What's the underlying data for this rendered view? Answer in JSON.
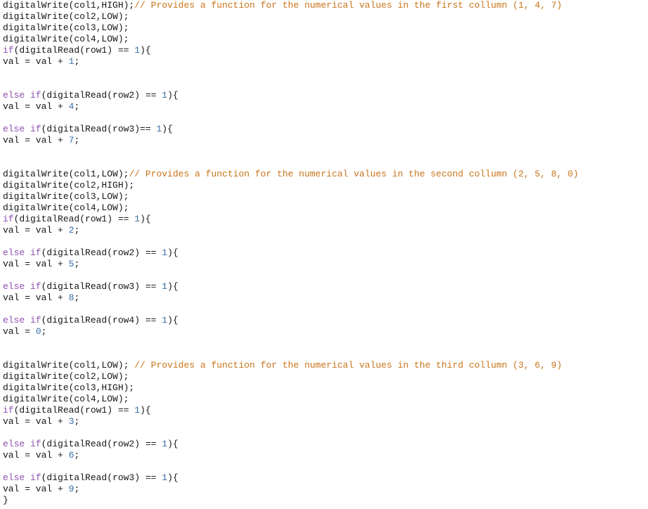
{
  "editor": {
    "language": "arduino-c",
    "background_color": "#ffffff",
    "colors": {
      "keyword": "#8f4faf",
      "number": "#3a6ea5",
      "comment": "#c8741b",
      "plain": "#161616"
    }
  },
  "code": {
    "lines": [
      {
        "segments": [
          {
            "t": "digitalWrite(col1,HIGH);",
            "c": "plain"
          },
          {
            "t": "// Provides a function for the numerical values in the first collumn (1, 4, 7)",
            "c": "comment"
          }
        ]
      },
      {
        "segments": [
          {
            "t": "digitalWrite(col2,LOW);",
            "c": "plain"
          }
        ]
      },
      {
        "segments": [
          {
            "t": "digitalWrite(col3,LOW);",
            "c": "plain"
          }
        ]
      },
      {
        "segments": [
          {
            "t": "digitalWrite(col4,LOW);",
            "c": "plain"
          }
        ]
      },
      {
        "segments": [
          {
            "t": "if",
            "c": "keyword"
          },
          {
            "t": "(digitalRead(row1) == ",
            "c": "plain"
          },
          {
            "t": "1",
            "c": "number"
          },
          {
            "t": "){",
            "c": "plain"
          }
        ]
      },
      {
        "segments": [
          {
            "t": "val = val + ",
            "c": "plain"
          },
          {
            "t": "1",
            "c": "number"
          },
          {
            "t": ";",
            "c": "plain"
          }
        ]
      },
      {
        "segments": []
      },
      {
        "segments": []
      },
      {
        "segments": [
          {
            "t": "else if",
            "c": "keyword"
          },
          {
            "t": "(digitalRead(row2) == ",
            "c": "plain"
          },
          {
            "t": "1",
            "c": "number"
          },
          {
            "t": "){",
            "c": "plain"
          }
        ]
      },
      {
        "segments": [
          {
            "t": "val = val + ",
            "c": "plain"
          },
          {
            "t": "4",
            "c": "number"
          },
          {
            "t": ";",
            "c": "plain"
          }
        ]
      },
      {
        "segments": []
      },
      {
        "segments": [
          {
            "t": "else if",
            "c": "keyword"
          },
          {
            "t": "(digitalRead(row3)== ",
            "c": "plain"
          },
          {
            "t": "1",
            "c": "number"
          },
          {
            "t": "){",
            "c": "plain"
          }
        ]
      },
      {
        "segments": [
          {
            "t": "val = val + ",
            "c": "plain"
          },
          {
            "t": "7",
            "c": "number"
          },
          {
            "t": ";",
            "c": "plain"
          }
        ]
      },
      {
        "segments": []
      },
      {
        "segments": []
      },
      {
        "segments": [
          {
            "t": "digitalWrite(col1,LOW);",
            "c": "plain"
          },
          {
            "t": "// Provides a function for the numerical values in the second collumn (2, 5, 8, 0)",
            "c": "comment"
          }
        ]
      },
      {
        "segments": [
          {
            "t": "digitalWrite(col2,HIGH);",
            "c": "plain"
          }
        ]
      },
      {
        "segments": [
          {
            "t": "digitalWrite(col3,LOW);",
            "c": "plain"
          }
        ]
      },
      {
        "segments": [
          {
            "t": "digitalWrite(col4,LOW);",
            "c": "plain"
          }
        ]
      },
      {
        "segments": [
          {
            "t": "if",
            "c": "keyword"
          },
          {
            "t": "(digitalRead(row1) == ",
            "c": "plain"
          },
          {
            "t": "1",
            "c": "number"
          },
          {
            "t": "){",
            "c": "plain"
          }
        ]
      },
      {
        "segments": [
          {
            "t": "val = val + ",
            "c": "plain"
          },
          {
            "t": "2",
            "c": "number"
          },
          {
            "t": ";",
            "c": "plain"
          }
        ]
      },
      {
        "segments": []
      },
      {
        "segments": [
          {
            "t": "else if",
            "c": "keyword"
          },
          {
            "t": "(digitalRead(row2) == ",
            "c": "plain"
          },
          {
            "t": "1",
            "c": "number"
          },
          {
            "t": "){",
            "c": "plain"
          }
        ]
      },
      {
        "segments": [
          {
            "t": "val = val + ",
            "c": "plain"
          },
          {
            "t": "5",
            "c": "number"
          },
          {
            "t": ";",
            "c": "plain"
          }
        ]
      },
      {
        "segments": []
      },
      {
        "segments": [
          {
            "t": "else if",
            "c": "keyword"
          },
          {
            "t": "(digitalRead(row3) == ",
            "c": "plain"
          },
          {
            "t": "1",
            "c": "number"
          },
          {
            "t": "){",
            "c": "plain"
          }
        ]
      },
      {
        "segments": [
          {
            "t": "val = val + ",
            "c": "plain"
          },
          {
            "t": "8",
            "c": "number"
          },
          {
            "t": ";",
            "c": "plain"
          }
        ]
      },
      {
        "segments": []
      },
      {
        "segments": [
          {
            "t": "else if",
            "c": "keyword"
          },
          {
            "t": "(digitalRead(row4) == ",
            "c": "plain"
          },
          {
            "t": "1",
            "c": "number"
          },
          {
            "t": "){",
            "c": "plain"
          }
        ]
      },
      {
        "segments": [
          {
            "t": "val = ",
            "c": "plain"
          },
          {
            "t": "0",
            "c": "number"
          },
          {
            "t": ";",
            "c": "plain"
          }
        ]
      },
      {
        "segments": []
      },
      {
        "segments": []
      },
      {
        "segments": [
          {
            "t": "digitalWrite(col1,LOW); ",
            "c": "plain"
          },
          {
            "t": "// Provides a function for the numerical values in the third collumn (3, 6, 9)",
            "c": "comment"
          }
        ]
      },
      {
        "segments": [
          {
            "t": "digitalWrite(col2,LOW);",
            "c": "plain"
          }
        ]
      },
      {
        "segments": [
          {
            "t": "digitalWrite(col3,HIGH);",
            "c": "plain"
          }
        ]
      },
      {
        "segments": [
          {
            "t": "digitalWrite(col4,LOW);",
            "c": "plain"
          }
        ]
      },
      {
        "segments": [
          {
            "t": "if",
            "c": "keyword"
          },
          {
            "t": "(digitalRead(row1) == ",
            "c": "plain"
          },
          {
            "t": "1",
            "c": "number"
          },
          {
            "t": "){",
            "c": "plain"
          }
        ]
      },
      {
        "segments": [
          {
            "t": "val = val + ",
            "c": "plain"
          },
          {
            "t": "3",
            "c": "number"
          },
          {
            "t": ";",
            "c": "plain"
          }
        ]
      },
      {
        "segments": []
      },
      {
        "segments": [
          {
            "t": "else if",
            "c": "keyword"
          },
          {
            "t": "(digitalRead(row2) == ",
            "c": "plain"
          },
          {
            "t": "1",
            "c": "number"
          },
          {
            "t": "){",
            "c": "plain"
          }
        ]
      },
      {
        "segments": [
          {
            "t": "val = val + ",
            "c": "plain"
          },
          {
            "t": "6",
            "c": "number"
          },
          {
            "t": ";",
            "c": "plain"
          }
        ]
      },
      {
        "segments": []
      },
      {
        "segments": [
          {
            "t": "else if",
            "c": "keyword"
          },
          {
            "t": "(digitalRead(row3) == ",
            "c": "plain"
          },
          {
            "t": "1",
            "c": "number"
          },
          {
            "t": "){",
            "c": "plain"
          }
        ]
      },
      {
        "segments": [
          {
            "t": "val = val + ",
            "c": "plain"
          },
          {
            "t": "9",
            "c": "number"
          },
          {
            "t": ";",
            "c": "plain"
          }
        ]
      },
      {
        "segments": [
          {
            "t": "}",
            "c": "plain"
          }
        ]
      }
    ]
  }
}
